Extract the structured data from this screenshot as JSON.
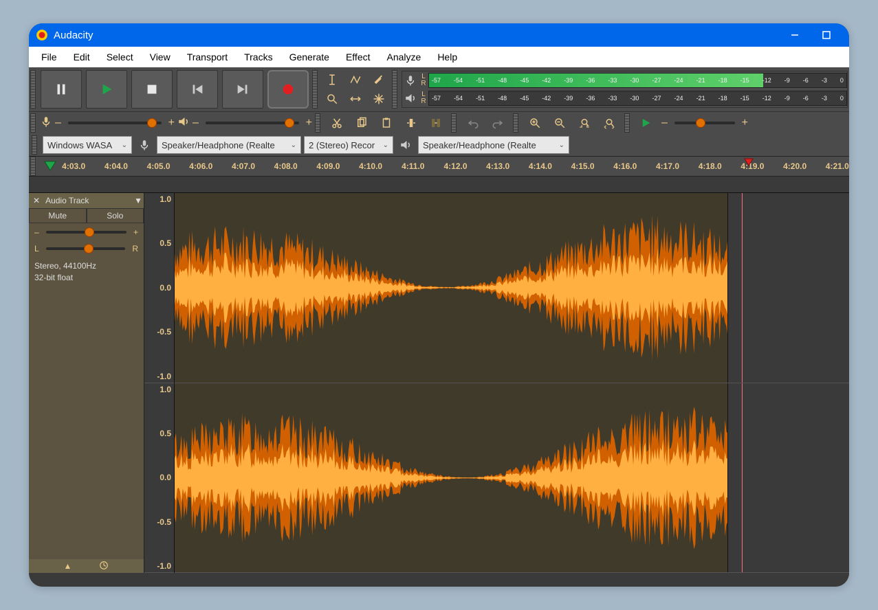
{
  "title": "Audacity",
  "menubar": [
    "File",
    "Edit",
    "Select",
    "View",
    "Transport",
    "Tracks",
    "Generate",
    "Effect",
    "Analyze",
    "Help"
  ],
  "meters": {
    "ticks": [
      "-57",
      "-54",
      "-51",
      "-48",
      "-45",
      "-42",
      "-39",
      "-36",
      "-33",
      "-30",
      "-27",
      "-24",
      "-21",
      "-18",
      "-15",
      "-12",
      "-9",
      "-6",
      "-3",
      "0"
    ],
    "L": "L",
    "R": "R"
  },
  "devices": {
    "host": "Windows WASA",
    "rec_device": "Speaker/Headphone (Realte",
    "channels": "2 (Stereo) Recor",
    "play_device": "Speaker/Headphone (Realte"
  },
  "timeline_ticks": [
    "4:03.0",
    "4:04.0",
    "4:05.0",
    "4:06.0",
    "4:07.0",
    "4:08.0",
    "4:09.0",
    "4:10.0",
    "4:11.0",
    "4:12.0",
    "4:13.0",
    "4:14.0",
    "4:15.0",
    "4:16.0",
    "4:17.0",
    "4:18.0",
    "4:19.0",
    "4:20.0",
    "4:21.0"
  ],
  "track": {
    "name": "Audio Track",
    "mute": "Mute",
    "solo": "Solo",
    "minus": "–",
    "plus": "+",
    "L": "L",
    "R": "R",
    "info1": "Stereo, 44100Hz",
    "info2": "32-bit float",
    "scale": [
      "1.0",
      "0.5",
      "0.0",
      "-0.5",
      "-1.0"
    ]
  },
  "colors": {
    "accent": "#e07000",
    "wave_dark": "#d06000",
    "wave_light": "#ffb040",
    "play_green": "#1fa64a",
    "record_red": "#e02020"
  }
}
